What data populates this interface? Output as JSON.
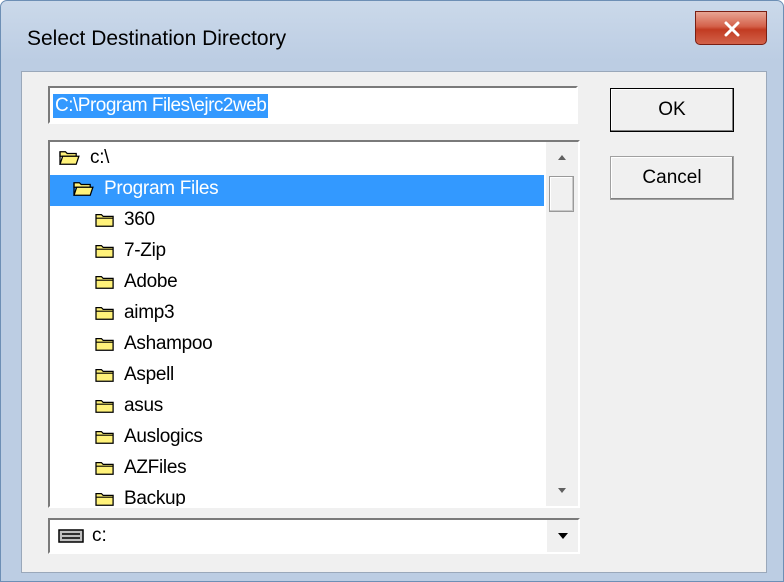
{
  "dialog": {
    "title": "Select Destination Directory",
    "close_label": "x"
  },
  "path_input": {
    "value": "C:\\Program Files\\ejrc2web"
  },
  "buttons": {
    "ok": "OK",
    "cancel": "Cancel"
  },
  "directory_list": {
    "items": [
      {
        "label": "c:\\",
        "icon": "open-folder-icon",
        "level": 0
      },
      {
        "label": "Program Files",
        "icon": "open-folder-icon",
        "level": 1,
        "selected": true
      },
      {
        "label": "360",
        "icon": "folder-icon",
        "level": 2
      },
      {
        "label": "7-Zip",
        "icon": "folder-icon",
        "level": 2
      },
      {
        "label": "Adobe",
        "icon": "folder-icon",
        "level": 2
      },
      {
        "label": "aimp3",
        "icon": "folder-icon",
        "level": 2
      },
      {
        "label": "Ashampoo",
        "icon": "folder-icon",
        "level": 2
      },
      {
        "label": "Aspell",
        "icon": "folder-icon",
        "level": 2
      },
      {
        "label": "asus",
        "icon": "folder-icon",
        "level": 2
      },
      {
        "label": "Auslogics",
        "icon": "folder-icon",
        "level": 2
      },
      {
        "label": "AZFiles",
        "icon": "folder-icon",
        "level": 2
      },
      {
        "label": "Backup",
        "icon": "folder-icon",
        "level": 2
      }
    ]
  },
  "drive_select": {
    "value": "c:",
    "icon": "drive-icon"
  },
  "colors": {
    "selection": "#3399ff",
    "folder": "#fff27a",
    "title_bar": "#c2d3e8",
    "close_button": "#c94a33"
  }
}
